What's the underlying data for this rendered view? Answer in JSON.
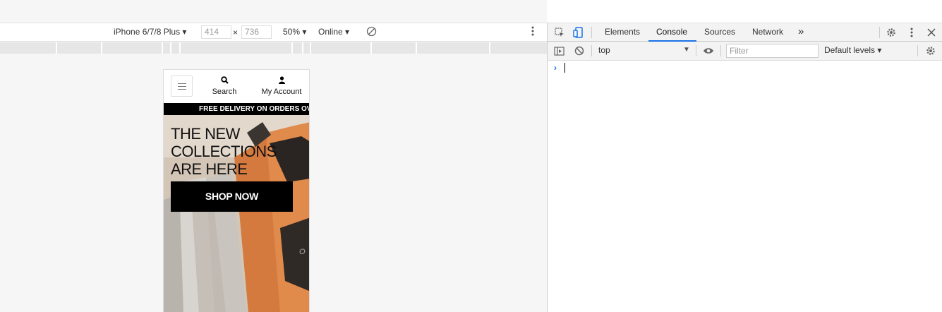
{
  "device_toolbar": {
    "device": "iPhone 6/7/8 Plus ▾",
    "width": "414",
    "times": "×",
    "height": "736",
    "zoom": "50% ▾",
    "network": "Online ▾"
  },
  "phone": {
    "nav": [
      {
        "label": "Search",
        "icon": "search-icon"
      },
      {
        "label": "My Account",
        "icon": "user-icon"
      }
    ],
    "promo": "FREE DELIVERY ON ORDERS OVER $",
    "hero_title": "THE NEW COLLECTIONS ARE HERE",
    "shop_button": "SHOP NOW"
  },
  "devtools": {
    "tabs": [
      {
        "label": "Elements",
        "active": false
      },
      {
        "label": "Console",
        "active": true
      },
      {
        "label": "Sources",
        "active": false
      },
      {
        "label": "Network",
        "active": false
      }
    ],
    "more_tabs": "»",
    "context": "top",
    "filter_placeholder": "Filter",
    "levels": "Default levels ▾",
    "prompt": "›",
    "accent": "#1a73e8"
  }
}
